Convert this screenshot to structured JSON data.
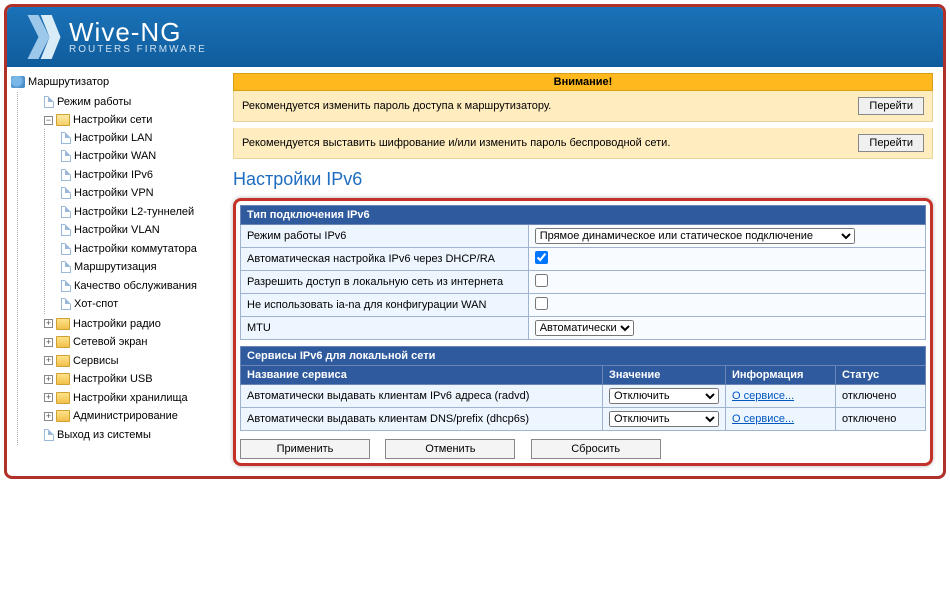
{
  "brand": {
    "title": "Wive-NG",
    "subtitle": "ROUTERS FIRMWARE"
  },
  "sidebar": {
    "root": "Маршрутизатор",
    "mode": "Режим работы",
    "net": "Настройки сети",
    "net_items": {
      "lan": "Настройки LAN",
      "wan": "Настройки WAN",
      "ipv6": "Настройки IPv6",
      "vpn": "Настройки VPN",
      "l2": "Настройки L2-туннелей",
      "vlan": "Настройки VLAN",
      "switch": "Настройки коммутатора",
      "routing": "Маршрутизация",
      "qos": "Качество обслуживания",
      "hotspot": "Хот-спот"
    },
    "radio": "Настройки радио",
    "fw": "Сетевой экран",
    "services": "Сервисы",
    "usb": "Настройки USB",
    "storage": "Настройки хранилища",
    "admin": "Администрирование",
    "logout": "Выход из системы"
  },
  "warn": {
    "title": "Внимание!",
    "row1": "Рекомендуется изменить пароль доступа к маршрутизатору.",
    "row2": "Рекомендуется выставить шифрование и/или изменить пароль беспроводной сети.",
    "btn": "Перейти"
  },
  "page_title": "Настройки IPv6",
  "ipv6": {
    "section_title": "Тип подключения IPv6",
    "rows": {
      "mode_label": "Режим работы IPv6",
      "mode_value": "Прямое динамическое или статическое подключение",
      "auto_label": "Автоматическая настройка IPv6 через DHCP/RA",
      "allow_label": "Разрешить доступ в локальную сеть из интернета",
      "no_iana_label": "Не использовать ia-na для конфигурации WAN",
      "mtu_label": "MTU",
      "mtu_value": "Автоматически"
    }
  },
  "svc": {
    "section_title": "Сервисы IPv6 для локальной сети",
    "cols": {
      "name": "Название сервиса",
      "val": "Значение",
      "info": "Информация",
      "status": "Статус"
    },
    "rows": [
      {
        "name": "Автоматически выдавать клиентам IPv6 адреса (radvd)",
        "val": "Отключить",
        "info": "О сервисе...",
        "status": "отключено"
      },
      {
        "name": "Автоматически выдавать клиентам DNS/prefix (dhcp6s)",
        "val": "Отключить",
        "info": "О сервисе...",
        "status": "отключено"
      }
    ]
  },
  "buttons": {
    "apply": "Применить",
    "cancel": "Отменить",
    "reset": "Сбросить"
  }
}
